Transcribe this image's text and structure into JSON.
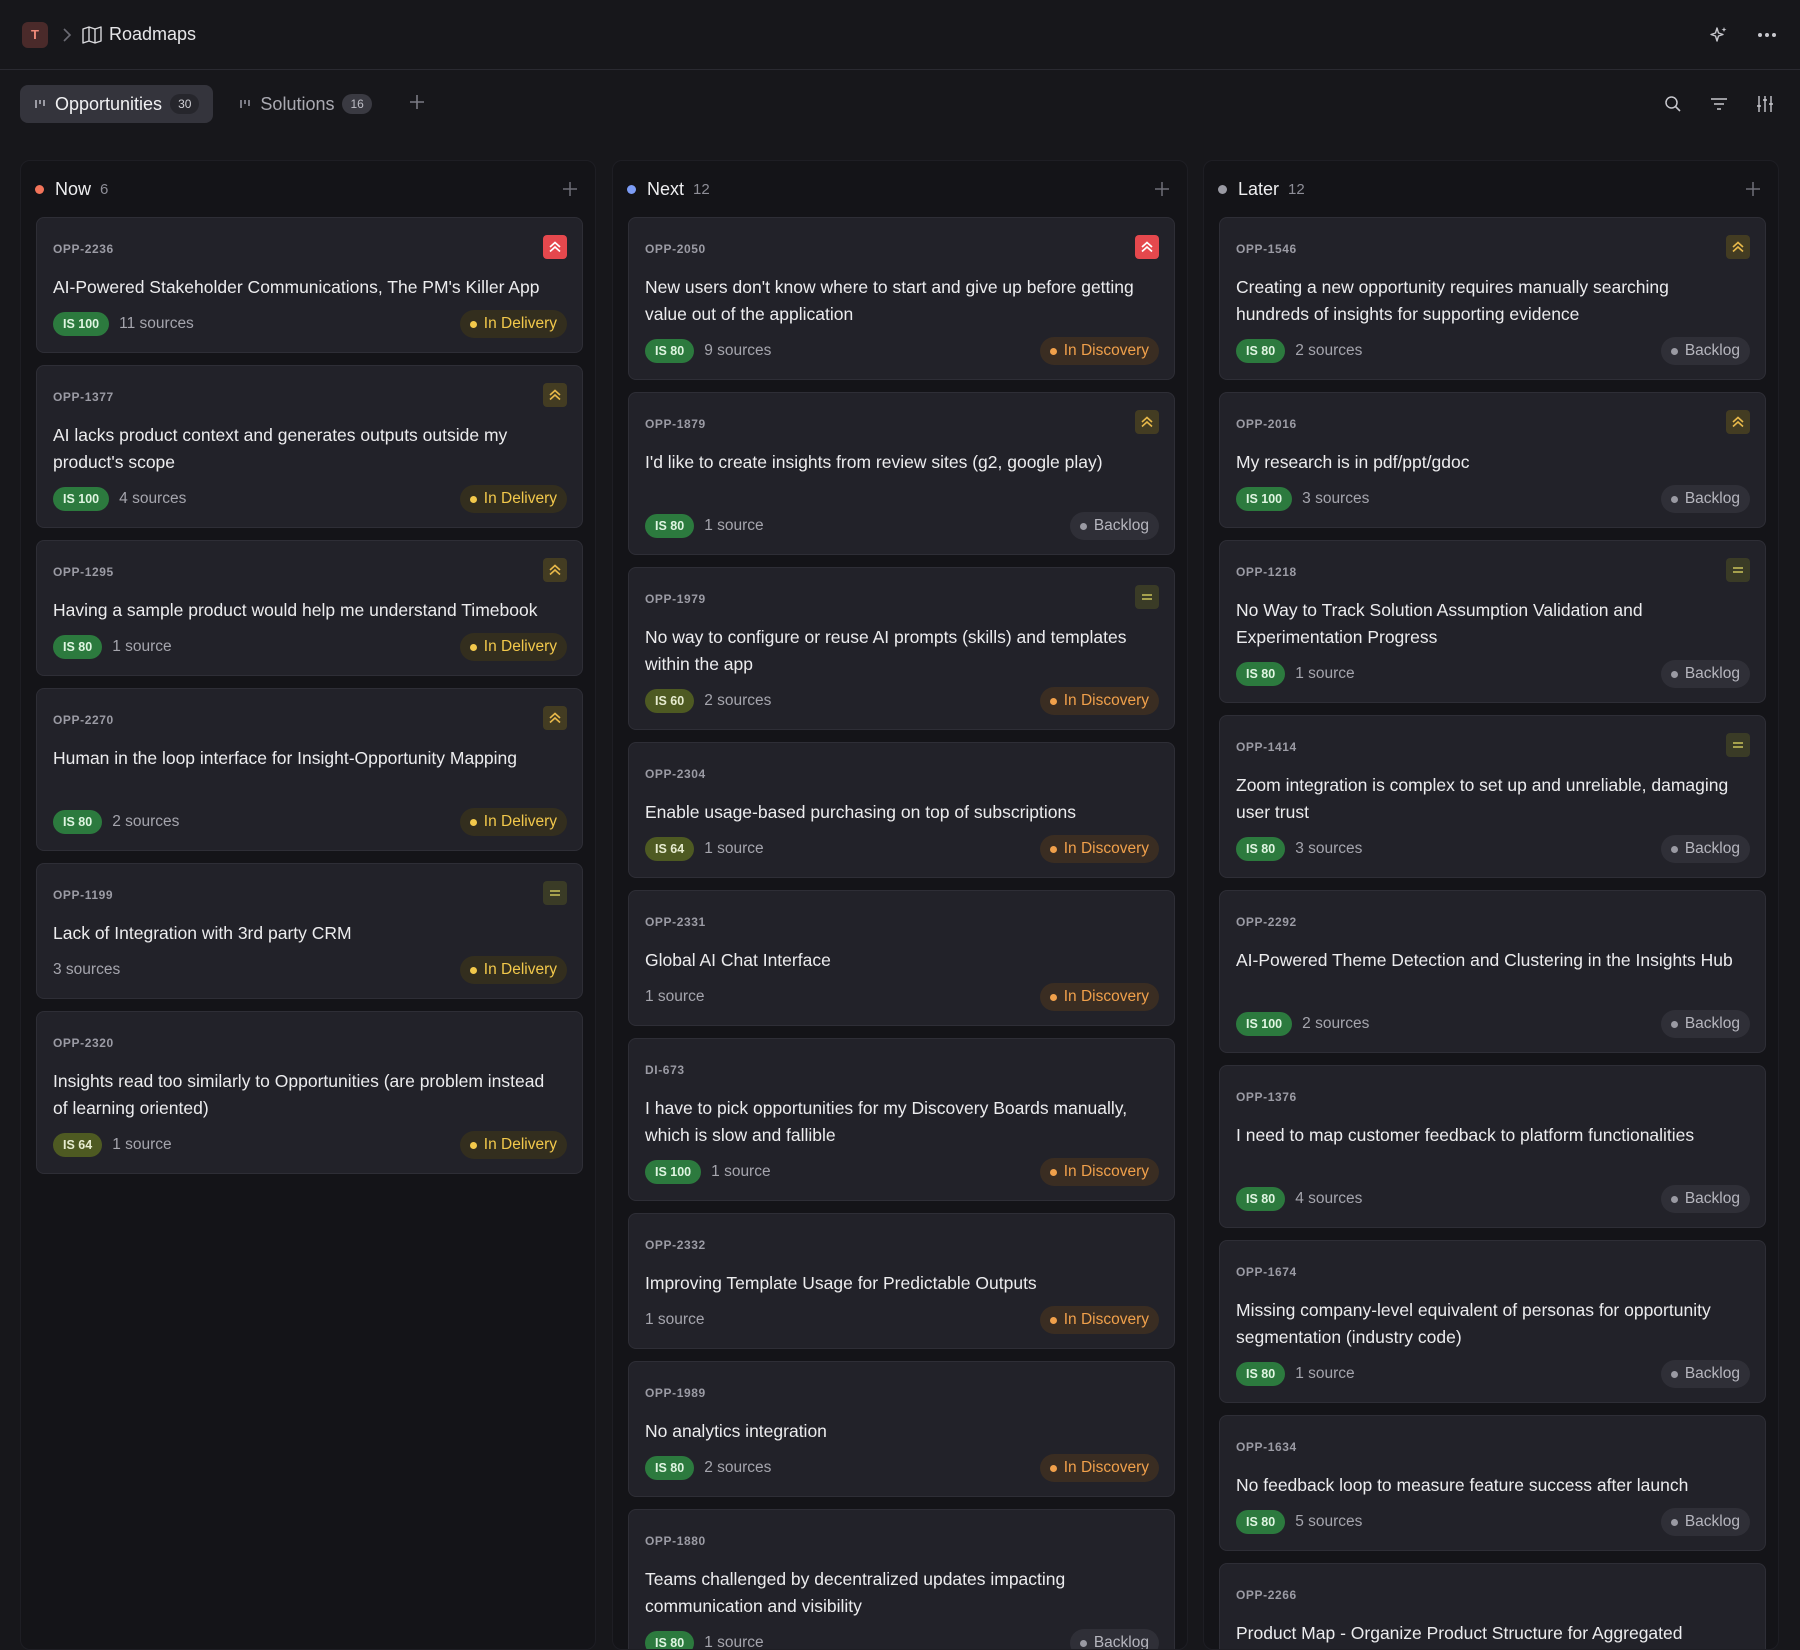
{
  "breadcrumb": {
    "workspace_initial": "T",
    "title": "Roadmaps"
  },
  "tabs": [
    {
      "label": "Opportunities",
      "count": "30",
      "active": true
    },
    {
      "label": "Solutions",
      "count": "16",
      "active": false
    }
  ],
  "columns": [
    {
      "title": "Now",
      "count": "6",
      "dot_color": "#f2745a",
      "cards": [
        {
          "id": "OPP-2236",
          "priority": "urgent",
          "title": "AI-Powered Stakeholder Communications, The PM's Killer App",
          "is": "IS 100",
          "sources": "11 sources",
          "status": "In Delivery"
        },
        {
          "id": "OPP-1377",
          "priority": "high",
          "title": "AI lacks product context and generates outputs outside my product's scope",
          "is": "IS 100",
          "sources": "4 sources",
          "status": "In Delivery"
        },
        {
          "id": "OPP-1295",
          "priority": "high",
          "title": "Having a sample product would help me understand Timebook",
          "is": "IS 80",
          "sources": "1 source",
          "status": "In Delivery"
        },
        {
          "id": "OPP-2270",
          "priority": "high",
          "title": "Human in the loop interface for Insight-Opportunity Mapping",
          "is": "IS 80",
          "sources": "2 sources",
          "status": "In Delivery"
        },
        {
          "id": "OPP-1199",
          "priority": "medium",
          "title": "Lack of Integration with 3rd party CRM",
          "is": "",
          "sources": "3 sources",
          "status": "In Delivery"
        },
        {
          "id": "OPP-2320",
          "priority": "",
          "title": "Insights read too similarly to Opportunities (are problem instead of learning oriented)",
          "is": "IS 64",
          "sources": "1 source",
          "status": "In Delivery"
        }
      ]
    },
    {
      "title": "Next",
      "count": "12",
      "dot_color": "#7c9cf5",
      "cards": [
        {
          "id": "OPP-2050",
          "priority": "urgent",
          "title": "New users don't know where to start and give up before getting value out of the application",
          "is": "IS 80",
          "sources": "9 sources",
          "status": "In Discovery"
        },
        {
          "id": "OPP-1879",
          "priority": "high",
          "title": "I'd like to create insights from review sites (g2, google play)",
          "is": "IS 80",
          "sources": "1 source",
          "status": "Backlog"
        },
        {
          "id": "OPP-1979",
          "priority": "medium",
          "title": "No way to configure or reuse AI prompts (skills) and templates within the app",
          "is": "IS 60",
          "sources": "2 sources",
          "status": "In Discovery"
        },
        {
          "id": "OPP-2304",
          "priority": "",
          "title": "Enable usage-based purchasing on top of subscriptions",
          "is": "IS 64",
          "sources": "1 source",
          "status": "In Discovery"
        },
        {
          "id": "OPP-2331",
          "priority": "",
          "title": "Global AI Chat Interface",
          "is": "",
          "sources": "1 source",
          "status": "In Discovery"
        },
        {
          "id": "DI-673",
          "priority": "",
          "title": "I have to pick opportunities for my Discovery Boards manually, which is slow and fallible",
          "is": "IS 100",
          "sources": "1 source",
          "status": "In Discovery"
        },
        {
          "id": "OPP-2332",
          "priority": "",
          "title": "Improving Template Usage for Predictable Outputs",
          "is": "",
          "sources": "1 source",
          "status": "In Discovery"
        },
        {
          "id": "OPP-1989",
          "priority": "",
          "title": "No analytics integration",
          "is": "IS 80",
          "sources": "2 sources",
          "status": "In Discovery"
        },
        {
          "id": "OPP-1880",
          "priority": "",
          "title": "Teams challenged by decentralized updates impacting communication and visibility",
          "is": "IS 80",
          "sources": "1 source",
          "status": "Backlog"
        }
      ]
    },
    {
      "title": "Later",
      "count": "12",
      "dot_color": "#9a9aa3",
      "cards": [
        {
          "id": "OPP-1546",
          "priority": "high",
          "title": "Creating a new opportunity requires manually searching hundreds of insights for supporting evidence",
          "is": "IS 80",
          "sources": "2 sources",
          "status": "Backlog"
        },
        {
          "id": "OPP-2016",
          "priority": "high",
          "title": "My research is in pdf/ppt/gdoc",
          "is": "IS 100",
          "sources": "3 sources",
          "status": "Backlog"
        },
        {
          "id": "OPP-1218",
          "priority": "medium",
          "title": "No Way to Track Solution Assumption Validation and Experimentation Progress",
          "is": "IS 80",
          "sources": "1 source",
          "status": "Backlog"
        },
        {
          "id": "OPP-1414",
          "priority": "medium",
          "title": "Zoom integration is complex to set up and unreliable, damaging user trust",
          "is": "IS 80",
          "sources": "3 sources",
          "status": "Backlog"
        },
        {
          "id": "OPP-2292",
          "priority": "",
          "title": "AI-Powered Theme Detection and Clustering in the Insights Hub",
          "is": "IS 100",
          "sources": "2 sources",
          "status": "Backlog"
        },
        {
          "id": "OPP-1376",
          "priority": "",
          "title": "I need to map customer feedback to platform functionalities",
          "is": "IS 80",
          "sources": "4 sources",
          "status": "Backlog"
        },
        {
          "id": "OPP-1674",
          "priority": "",
          "title": "Missing company-level equivalent of personas for opportunity segmentation (industry code)",
          "is": "IS 80",
          "sources": "1 source",
          "status": "Backlog"
        },
        {
          "id": "OPP-1634",
          "priority": "",
          "title": "No feedback loop to measure feature success after launch",
          "is": "IS 80",
          "sources": "5 sources",
          "status": "Backlog"
        },
        {
          "id": "OPP-2266",
          "priority": "",
          "title": "Product Map - Organize Product Structure for Aggregated Intelligence",
          "is": "",
          "sources": "",
          "status": ""
        }
      ]
    }
  ],
  "colors": {
    "background": "#17171b",
    "card": "#222229",
    "urgent": "#e5484d",
    "in_delivery": "#f2c84b",
    "in_discovery": "#f0a04b",
    "is_high": "#2c7a3e"
  }
}
